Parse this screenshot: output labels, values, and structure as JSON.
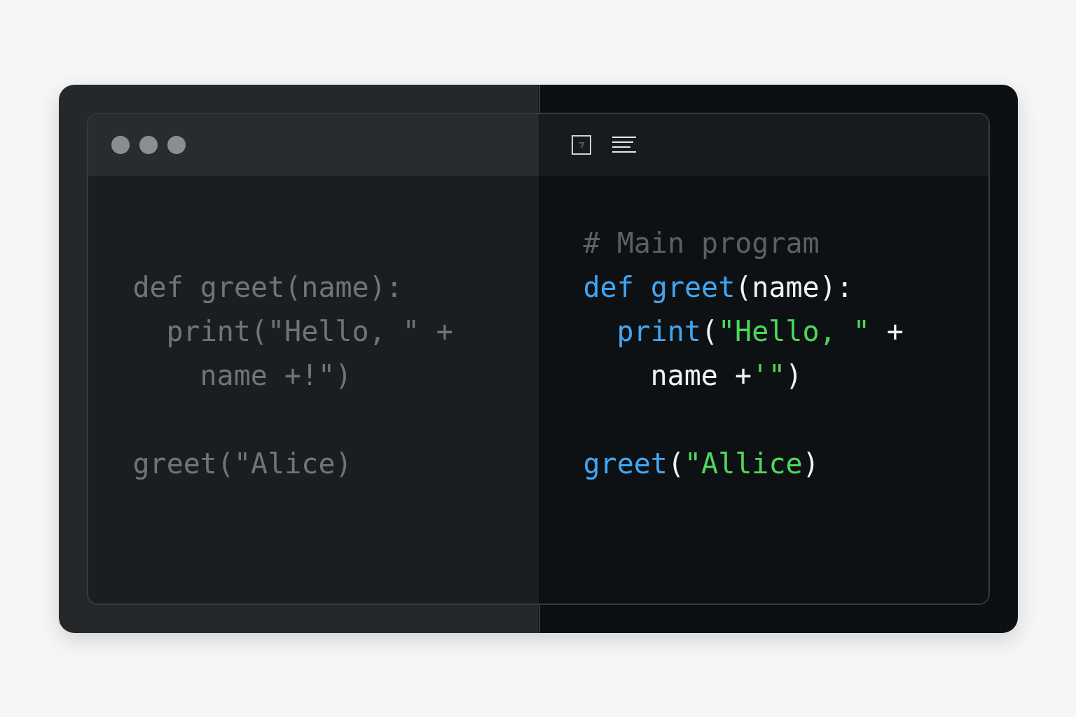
{
  "panes": [
    {
      "blocks": [
        [
          {
            "tokens": [
              {
                "kind": "dim",
                "text": "def greet(name):"
              }
            ],
            "children": [
              {
                "tokens": [
                  {
                    "kind": "dim",
                    "text": "print(\"Hello, \" +"
                  }
                ],
                "children": [
                  {
                    "tokens": [
                      {
                        "kind": "dim",
                        "text": "name +!\")"
                      }
                    ]
                  }
                ]
              }
            ]
          }
        ],
        [
          {
            "tokens": [
              {
                "kind": "dim",
                "text": "greet(\"Alice)"
              }
            ]
          }
        ]
      ]
    },
    {
      "blocks": [
        [
          {
            "tokens": [
              {
                "kind": "comment",
                "text": "# Main program"
              }
            ]
          },
          {
            "tokens": [
              {
                "kind": "keyword",
                "text": "def "
              },
              {
                "kind": "function",
                "text": "greet"
              },
              {
                "kind": "plain",
                "text": "(name):"
              }
            ],
            "children": [
              {
                "tokens": [
                  {
                    "kind": "function",
                    "text": "print"
                  },
                  {
                    "kind": "plain",
                    "text": "("
                  },
                  {
                    "kind": "string",
                    "text": "\"Hello, \""
                  },
                  {
                    "kind": "plain",
                    "text": " +"
                  }
                ],
                "children": [
                  {
                    "tokens": [
                      {
                        "kind": "plain",
                        "text": "name +"
                      },
                      {
                        "kind": "string",
                        "text": "'\""
                      },
                      {
                        "kind": "plain",
                        "text": ")"
                      }
                    ]
                  }
                ]
              }
            ]
          }
        ],
        [
          {
            "tokens": [
              {
                "kind": "function",
                "text": "greet"
              },
              {
                "kind": "plain",
                "text": "("
              },
              {
                "kind": "string",
                "text": "\"Allice"
              },
              {
                "kind": "plain",
                "text": ")"
              }
            ]
          }
        ]
      ]
    }
  ]
}
